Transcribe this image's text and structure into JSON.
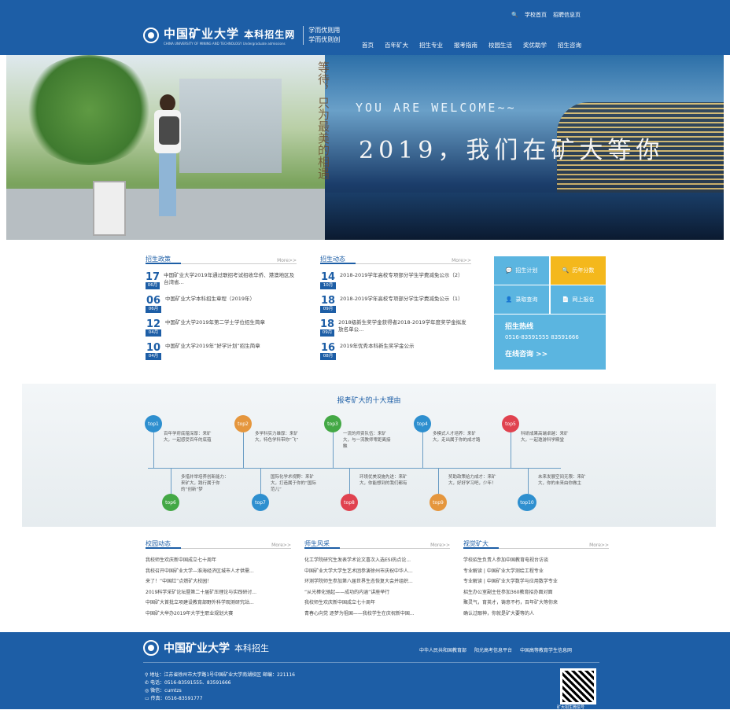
{
  "header": {
    "top_links": [
      "学校首页",
      "招聘信息页"
    ],
    "logo_text": "中国矿业大学",
    "logo_suffix": "本科招生网",
    "logo_small": "CHINA UNIVERSITY OF MINING AND TECHNOLOGY   Undergraduate admissions",
    "motto1": "学而优则用",
    "motto2": "学而优则创",
    "nav": [
      "首页",
      "百年矿大",
      "招生专业",
      "报考指南",
      "校园生活",
      "奖优助学",
      "招生咨询"
    ]
  },
  "banner": {
    "vertical": "等待，只为最美的相遇",
    "welcome": "YOU ARE WELCOME~~",
    "slogan": "2019，我们在矿大等你"
  },
  "policy": {
    "title": "招生政策",
    "more": "More>>",
    "items": [
      {
        "day": "17",
        "month": "06月",
        "text": "中国矿业大学2019年通过联招考试招收华侨、港澳地区及台湾省..."
      },
      {
        "day": "06",
        "month": "06月",
        "text": "中国矿业大学本科招生章程（2019年）"
      },
      {
        "day": "12",
        "month": "04月",
        "text": "中国矿业大学2019年第二学士学位招生简章"
      },
      {
        "day": "10",
        "month": "04月",
        "text": "中国矿业大学2019年“好学计划”招生简章"
      }
    ]
  },
  "dynamics": {
    "title": "招生动态",
    "more": "More>>",
    "items": [
      {
        "day": "14",
        "month": "10月",
        "text": "2018-2019学年高校专项部分学生学费减免公示（2）"
      },
      {
        "day": "18",
        "month": "09月",
        "text": "2018-2019学年高校专项部分学生学费减免公示（1）"
      },
      {
        "day": "18",
        "month": "09月",
        "text": "2018级新生奖学金获得者2018-2019学年度奖学金拟发放名单公..."
      },
      {
        "day": "16",
        "month": "08月",
        "text": "2019年优秀本科新生奖学金公示"
      }
    ]
  },
  "tiles": {
    "plan": "招生计划",
    "score": "历年分数",
    "query": "录取查询",
    "signup": "网上报名",
    "hotline_title": "招生热线",
    "hotline_phone": "0516-83591555   83591666",
    "consult": "在线咨询 >>"
  },
  "reasons": {
    "title": "报考矿大的十大理由",
    "items": [
      {
        "tag": "top1",
        "text": "百年学府底蕴深厚：来矿大，一起感受百年的底蕴"
      },
      {
        "tag": "top2",
        "text": "多学科实力雄厚：来矿大，特色学科带你“飞”"
      },
      {
        "tag": "top3",
        "text": "一流的师资队伍：来矿大，与一流教师零距离接触"
      },
      {
        "tag": "top4",
        "text": "多模式人才培养：来矿大，走出属于你的成才路"
      },
      {
        "tag": "top5",
        "text": "科研成果高端卓越：来矿大，一起邀游科学殿堂"
      },
      {
        "tag": "top6",
        "text": "多措并举培养创新能力：来矿大，践行属于你的“创新”梦"
      },
      {
        "tag": "top7",
        "text": "国际化学术视野：来矿大，打造属于你的“国际范儿”"
      },
      {
        "tag": "top8",
        "text": "环境优美设施先进：来矿大，你能想到的我们都有"
      },
      {
        "tag": "top9",
        "text": "奖助政策给力成才：来矿大，好好学习吧，少年！"
      },
      {
        "tag": "top10",
        "text": "未来发展空间无限：来矿大，你的未来由你做主"
      }
    ]
  },
  "campus_news": {
    "title": "校园动态",
    "more": "More>>",
    "items": [
      "我校师生欢庆新中国成立七十周年",
      "我校召开中国矿业大学—淮海经济区城市人才供需...",
      "来了！“中国红”点燃矿大校园！",
      "2019科学采矿论坛暨第二十届矿压理论与实践研讨...",
      "中国矿大首批立项建设教育部野外科学观测研究站...",
      "中国矿大举办2019年大学生职业规划大赛"
    ]
  },
  "style_news": {
    "title": "师生风采",
    "more": "More>>",
    "items": [
      "化工学院研究生发表学术论文喜次入选ESI热点论...",
      "中国矿业大学大学生艺术团参演徐州市庆祝中华人...",
      "环测学院师生参加第八届世界生态恢复大会并组织...",
      "“从光棒化驰起——成功的内涵”讲座举行",
      "我校师生欢庆新中国成立七十周年",
      "青春心向党 逐梦为祖国——我校学生在庆祝新中国..."
    ]
  },
  "video_news": {
    "title": "视觉矿大",
    "more": "More>>",
    "items": [
      "学校招生负责人参加中国教育电视台访谈",
      "专业解读 | 中国矿业大学测绘工程专业",
      "专业解读 | 中国矿业大学数学与应用数学专业",
      "招生办公室副主任参加360教育招办面对面",
      "聚灵气，育英才，铸意不朽，百年矿大等你来",
      "确认过眼神，你就是矿大要等的人"
    ]
  },
  "footer": {
    "logo_text": "中国矿业大学",
    "logo_suffix": "本科招生",
    "links": [
      "中华人民共和国教育部",
      "阳光高考信息平台",
      "中国高等教育学生信息网"
    ],
    "address": "地址：江苏省徐州市大学路1号中国矿业大学南湖校区 邮编：221116",
    "phone": "电话：0516-83591555、83591666",
    "wechat": "微信：cumtzs",
    "fax": "传真：0516-83591777",
    "qr_label": "矿大招生微信号"
  },
  "colors": {
    "primary": "#1d5ea6",
    "tile_blue": "#5bb5e0",
    "tile_yellow": "#f4b81c"
  }
}
